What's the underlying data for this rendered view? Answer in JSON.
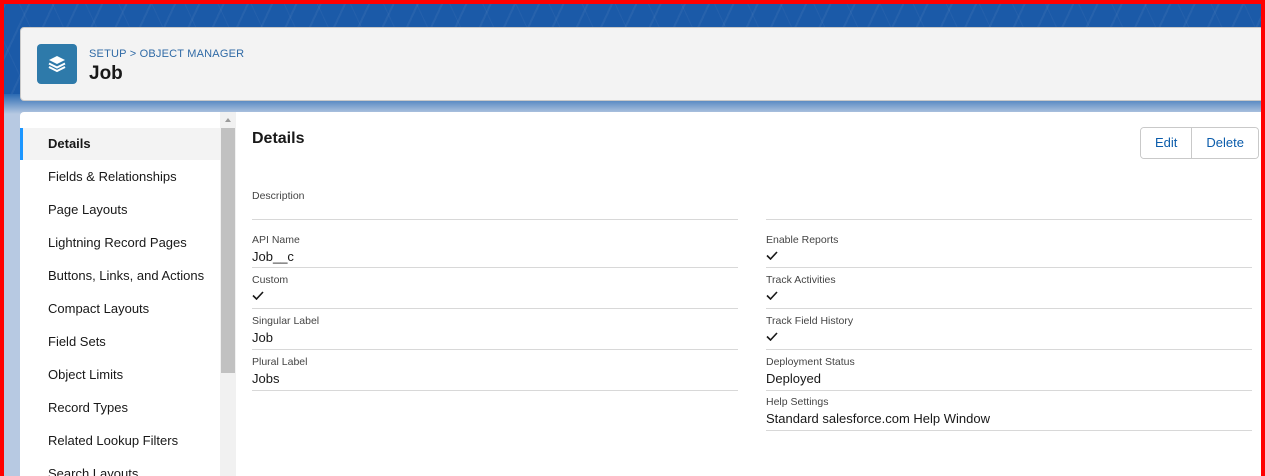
{
  "header": {
    "breadcrumb": "SETUP > OBJECT MANAGER",
    "title": "Job"
  },
  "sidebar": {
    "items": [
      {
        "label": "Details",
        "active": true
      },
      {
        "label": "Fields & Relationships"
      },
      {
        "label": "Page Layouts"
      },
      {
        "label": "Lightning Record Pages"
      },
      {
        "label": "Buttons, Links, and Actions"
      },
      {
        "label": "Compact Layouts"
      },
      {
        "label": "Field Sets"
      },
      {
        "label": "Object Limits"
      },
      {
        "label": "Record Types"
      },
      {
        "label": "Related Lookup Filters"
      },
      {
        "label": "Search Layouts"
      }
    ]
  },
  "main": {
    "title": "Details",
    "edit_label": "Edit",
    "delete_label": "Delete",
    "description": {
      "label": "Description",
      "value": ""
    },
    "left_fields": [
      {
        "label": "API Name",
        "value": "Job__c"
      },
      {
        "label": "Custom",
        "value": "✓",
        "checked": true
      },
      {
        "label": "Singular Label",
        "value": "Job"
      },
      {
        "label": "Plural Label",
        "value": "Jobs"
      }
    ],
    "right_fields": [
      {
        "label": "Enable Reports",
        "checked": true
      },
      {
        "label": "Track Activities",
        "checked": true
      },
      {
        "label": "Track Field History",
        "checked": true
      },
      {
        "label": "Deployment Status",
        "value": "Deployed"
      },
      {
        "label": "Help Settings",
        "value": "Standard salesforce.com Help Window"
      }
    ]
  },
  "colors": {
    "accent": "#1b96ff",
    "link": "#0b5cab",
    "header_icon_bg": "#2e7aaa",
    "border_highlight": "#ff0000"
  },
  "icons": {
    "header": "layers-icon",
    "checkmark": "check-icon"
  }
}
